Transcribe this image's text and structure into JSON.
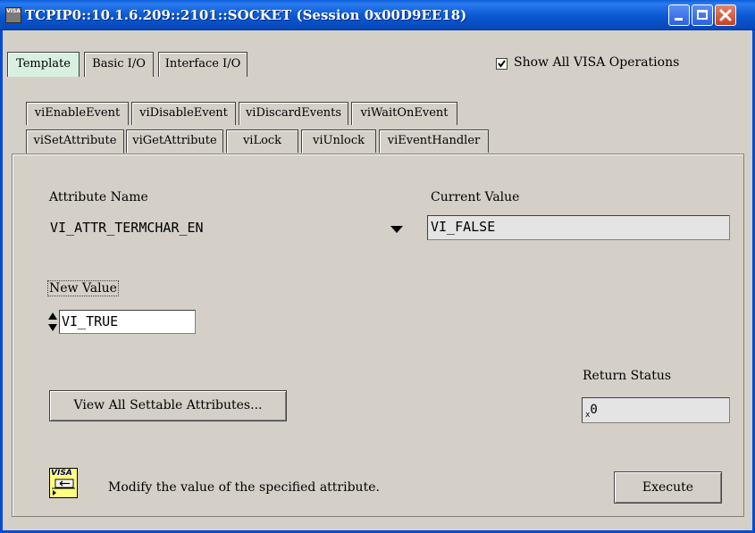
{
  "window": {
    "title": "TCPIP0::10.1.6.209::2101::SOCKET (Session 0x00D9EE18)",
    "icon_text": "VISA"
  },
  "main_tabs": [
    {
      "label": "Template",
      "active": true
    },
    {
      "label": "Basic I/O",
      "active": false
    },
    {
      "label": "Interface I/O",
      "active": false
    }
  ],
  "show_all": {
    "label": "Show All VISA Operations",
    "checked": true
  },
  "inner_tabs_row1": [
    {
      "label": "viEnableEvent"
    },
    {
      "label": "viDisableEvent"
    },
    {
      "label": "viDiscardEvents"
    },
    {
      "label": "viWaitOnEvent"
    }
  ],
  "inner_tabs_row2": [
    {
      "label": "viSetAttribute",
      "active": true
    },
    {
      "label": "viGetAttribute"
    },
    {
      "label": "viLock"
    },
    {
      "label": "viUnlock"
    },
    {
      "label": "viEventHandler"
    }
  ],
  "form": {
    "attribute_name_label": "Attribute Name",
    "attribute_name_value": "VI_ATTR_TERMCHAR_EN",
    "current_value_label": "Current Value",
    "current_value": "VI_FALSE",
    "new_value_label": "New Value",
    "new_value": "VI_TRUE",
    "view_button": "View All Settable Attributes...",
    "return_status_label": "Return Status",
    "return_status_prefix": "x",
    "return_status_value": "0",
    "visa_icon_text": "VISA",
    "description": "Modify the value of the specified attribute.",
    "execute_button": "Execute"
  },
  "colors": {
    "titlebar": "#0a58d0",
    "active_tab": "#d8f0e0",
    "dialog_bg": "#d4d0c8"
  }
}
